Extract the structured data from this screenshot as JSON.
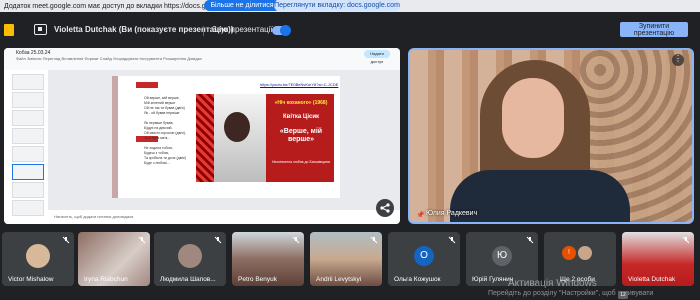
{
  "notification": {
    "text": "Додаток meet.google.com має доступ до вкладки https://docs.google.com",
    "stop_label": "Більше не ділитися",
    "switch_label": "Переглянути вкладку: docs.google.com"
  },
  "presentation_bar": {
    "title": "Violetta Dutchak (Ви (показуєте презентацію))",
    "sound_label": "Звук презентації",
    "sound_on": true,
    "stop_button": "Зупинити презентацію"
  },
  "slides_app": {
    "file_name": "Кобза 25.03.24",
    "menu": "Файл Змінити Перегляд Вставлення Формат Слайд Упорядкувати Інструменти Розширення Довідка",
    "share": "Надати доступ",
    "notes": "Натисніть, щоб додати нотатки доповідача"
  },
  "slide": {
    "link": "https://youtu.be/7E0BeNvKmY8?si=C-JCDE",
    "poem": [
      "Ой верше, мій верше,",
      "Мій зелений верше",
      "Ой не так ти бував (двічі)",
      "Як - ой бував первіше",
      "",
      "Як первіше бував,",
      "Будує на дівочий.",
      "Ой свисні сорокою (двічі),",
      "Та й бува мені...",
      "",
      "Не ходила тобою,",
      "Будеш з тобою,",
      "Та зробила ти доче (двічі)",
      "Буде з любові..."
    ],
    "poster_title": "«Ніч коханого» (1968)",
    "poster_name": "Квітка Цісик",
    "poster_song": "«Верше, мій верше»",
    "poster_caption": "Нескінченна любов до Батьківщини"
  },
  "speaker": {
    "name": "Юлия Радкевич"
  },
  "participants": [
    {
      "name": "Victor Mishalow",
      "type": "photo"
    },
    {
      "name": "Iryna Riabchun",
      "type": "video"
    },
    {
      "name": "Людмила Шапов...",
      "type": "photo"
    },
    {
      "name": "Petro Benyuk",
      "type": "video"
    },
    {
      "name": "Andrii Levytskyi",
      "type": "video"
    },
    {
      "name": "Ольга Кожушок",
      "type": "avatar",
      "initial": "О",
      "color": "#1565c0"
    },
    {
      "name": "Юрій Гулянич",
      "type": "avatar",
      "initial": "Ю",
      "color": "#5f6368"
    },
    {
      "name": "Ще 2 особи",
      "type": "more"
    },
    {
      "name": "Violetta Dutchak",
      "type": "video"
    }
  ],
  "watermark": {
    "line1": "Активація Windows",
    "line2": "Перейдіть до розділу \"Настройки\", щоб активувати",
    "badge": "12"
  }
}
